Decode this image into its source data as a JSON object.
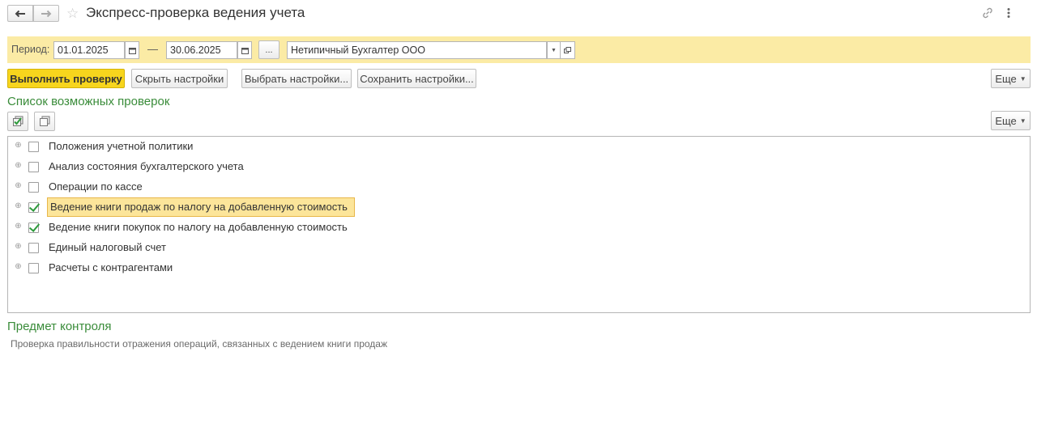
{
  "header": {
    "title": "Экспресс-проверка ведения учета",
    "back_icon": "arrow-left-icon",
    "forward_icon": "arrow-right-icon",
    "favorite_icon": "star-icon",
    "link_icon": "link-icon",
    "menu_icon": "vertical-dots-icon"
  },
  "period": {
    "label": "Период:",
    "from": "01.01.2025",
    "separator": "—",
    "to": "30.06.2025",
    "ellipsis_label": "...",
    "organization": "Нетипичный Бухгалтер ООО"
  },
  "toolbar": {
    "run_label": "Выполнить проверку",
    "hide_settings_label": "Скрыть настройки",
    "choose_settings_label": "Выбрать настройки...",
    "save_settings_label": "Сохранить настройки...",
    "more_label": "Еще"
  },
  "checks": {
    "title": "Список возможных проверок",
    "more_label": "Еще",
    "items": [
      {
        "label": "Положения учетной политики",
        "checked": false,
        "selected": false
      },
      {
        "label": "Анализ состояния бухгалтерского учета",
        "checked": false,
        "selected": false
      },
      {
        "label": "Операции по кассе",
        "checked": false,
        "selected": false
      },
      {
        "label": "Ведение книги продаж по налогу на добавленную стоимость",
        "checked": true,
        "selected": true
      },
      {
        "label": "Ведение книги покупок по налогу на добавленную стоимость",
        "checked": true,
        "selected": false
      },
      {
        "label": "Единый налоговый счет",
        "checked": false,
        "selected": false
      },
      {
        "label": "Расчеты с контрагентами",
        "checked": false,
        "selected": false
      }
    ]
  },
  "control": {
    "title": "Предмет контроля",
    "description": "Проверка правильности отражения операций, связанных с ведением книги продаж"
  },
  "colors": {
    "accent_yellow": "#f7d51d",
    "panel_yellow": "#fbeba5",
    "section_green": "#3a8c3a",
    "check_green": "#2e9b3c"
  }
}
